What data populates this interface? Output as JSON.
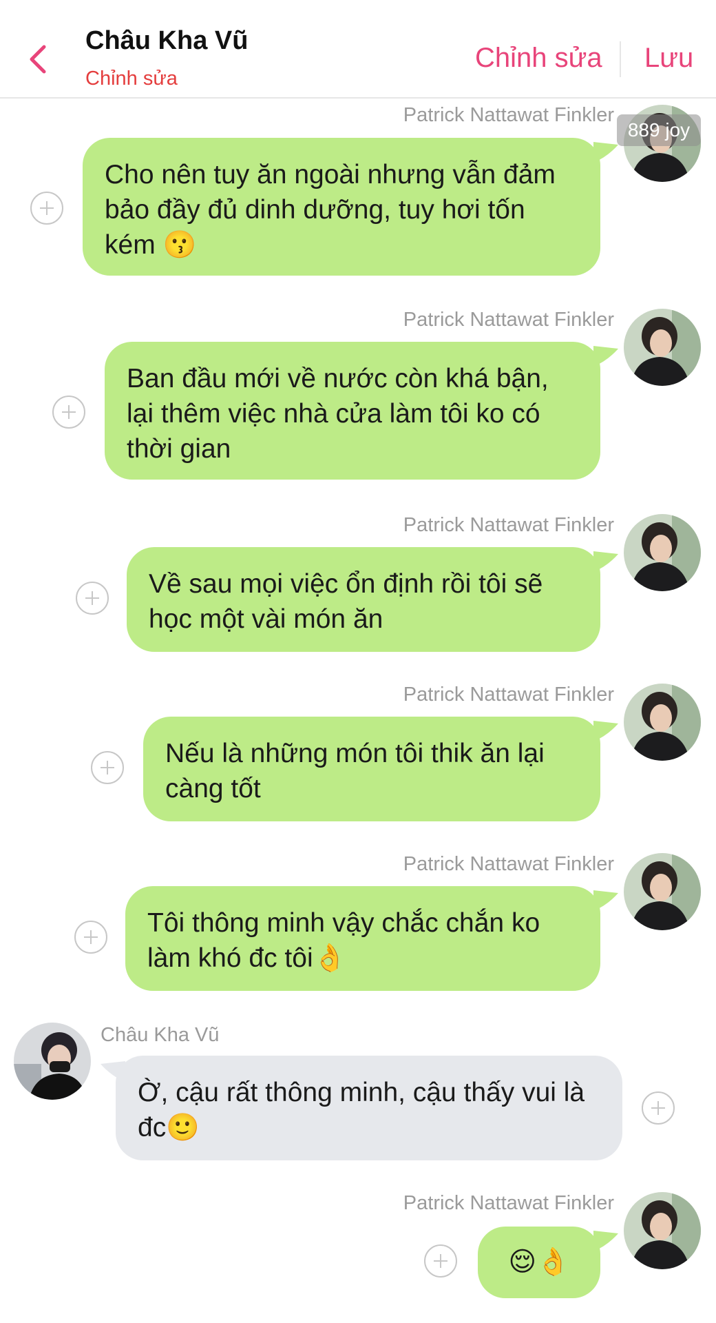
{
  "header": {
    "title": "Châu Kha Vũ",
    "subtitle": "Chỉnh sửa",
    "edit_label": "Chỉnh sửa",
    "save_label": "Lưu"
  },
  "watermark": "889 joy",
  "colors": {
    "accent": "#e8447a",
    "subtitle": "#e43d3d",
    "outgoing_bubble": "#bdeb87",
    "incoming_bubble": "#e6e8ec"
  },
  "messages": [
    {
      "sender": "Patrick Nattawat Finkler",
      "text": "Cho nên tuy ăn ngoài nhưng vẫn đảm bảo đầy đủ dinh dưỡng, tuy hơi tốn kém 😗"
    },
    {
      "sender": "Patrick Nattawat Finkler",
      "text": "Ban đầu mới về nước còn khá bận, lại thêm việc nhà cửa làm tôi ko có thời gian"
    },
    {
      "sender": "Patrick Nattawat Finkler",
      "text": "Về sau mọi việc ổn định rồi tôi sẽ học một vài món ăn"
    },
    {
      "sender": "Patrick Nattawat Finkler",
      "text": "Nếu là những món tôi thik ăn lại càng tốt"
    },
    {
      "sender": "Patrick Nattawat Finkler",
      "text": "Tôi thông minh vậy chắc chắn ko làm khó đc tôi👌"
    },
    {
      "sender": "Châu Kha Vũ",
      "text": "Ờ, cậu rất thông minh, cậu  thấy vui là đc🙂"
    },
    {
      "sender": "Patrick Nattawat Finkler",
      "text": "😌👌"
    }
  ]
}
